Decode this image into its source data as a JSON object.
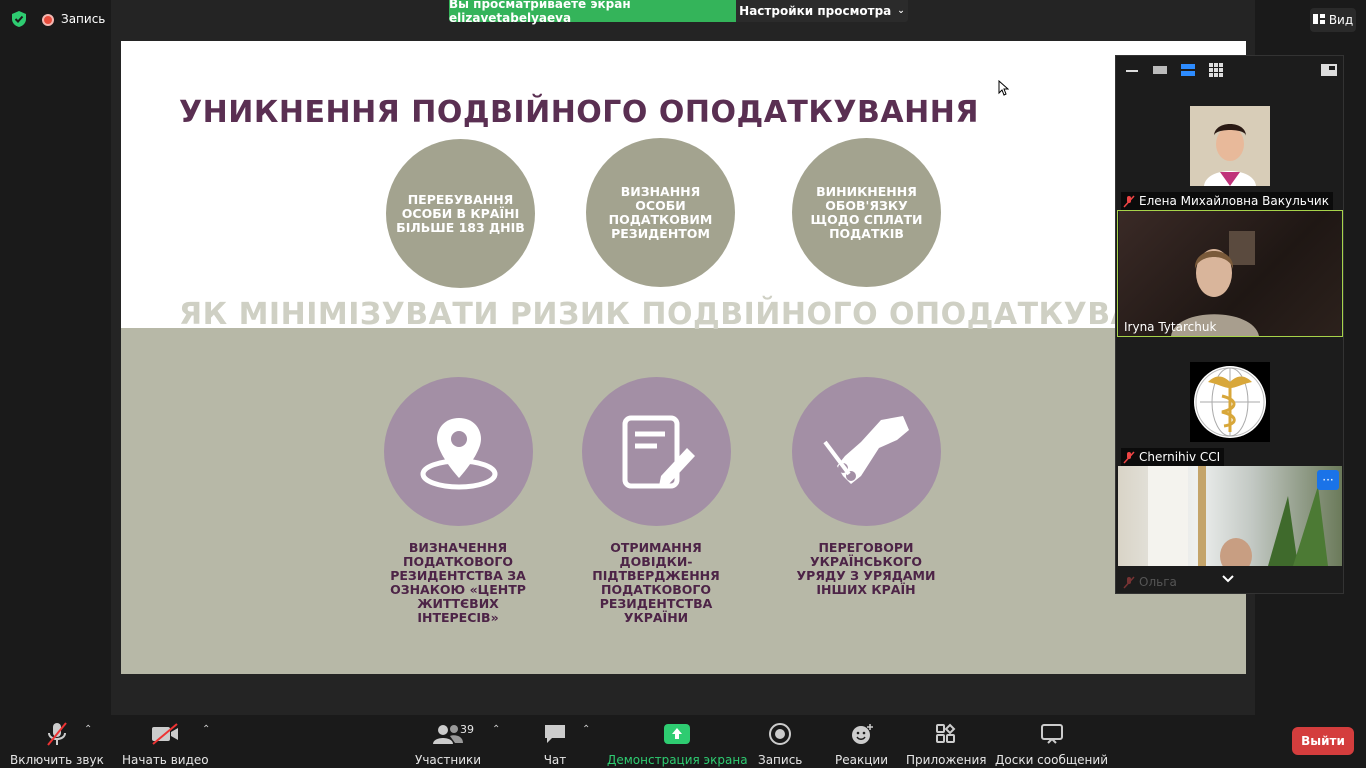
{
  "topbar": {
    "record_label": "Запись",
    "viewing_banner": "Вы просматриваете экран elizavetabelyaeva",
    "view_settings": "Настройки просмотра",
    "view_button": "Вид"
  },
  "slide": {
    "title": "УНИКНЕННЯ ПОДВІЙНОГО ОПОДАТКУВАННЯ",
    "subtitle": "ЯК МІНІМІЗУВАТИ РИЗИК ПОДВІЙНОГО ОПОДАТКУВАННЯ",
    "circles_top": [
      "ПЕРЕБУВАННЯ ОСОБИ В КРАЇНІ БІЛЬШЕ 183 ДНІВ",
      "ВИЗНАННЯ ОСОБИ ПОДАТКОВИМ РЕЗИДЕНТОМ",
      "ВИНИКНЕННЯ ОБОВ'ЯЗКУ ЩОДО СПЛАТИ ПОДАТКІВ"
    ],
    "captions_bottom": [
      "ВИЗНАЧЕННЯ ПОДАТКОВОГО РЕЗИДЕНТСТВА ЗА ОЗНАКОЮ «ЦЕНТР ЖИТТЄВИХ ІНТЕРЕСІВ»",
      "ОТРИМАННЯ ДОВІДКИ-ПІДТВЕРДЖЕННЯ ПОДАТКОВОГО РЕЗИДЕНТСТВА УКРАЇНИ",
      "ПЕРЕГОВОРИ УКРАЇНСЬКОГО УРЯДУ З УРЯДАМИ ІНШИХ КРАЇН"
    ],
    "icons_bottom": [
      "map-pin-icon",
      "document-edit-icon",
      "handshake-icon"
    ]
  },
  "participants": [
    {
      "name": "Елена Михайловна Вакульчик",
      "muted": true
    },
    {
      "name": "Iryna Tytarchuk",
      "muted": false
    },
    {
      "name": "Chernihiv CCI",
      "muted": true
    },
    {
      "name": "Ольга",
      "muted": true
    }
  ],
  "toolbar": {
    "mute": "Включить звук",
    "video": "Начать видео",
    "participants": "Участники",
    "participants_count": "39",
    "chat": "Чат",
    "share": "Демонстрация экрана",
    "record": "Запись",
    "reactions": "Реакции",
    "apps": "Приложения",
    "whiteboards": "Доски сообщений",
    "leave": "Выйти"
  },
  "colors": {
    "share_green": "#34b45a",
    "leave_red": "#d43d3d",
    "slide_title": "#5a2f52",
    "circle_gray": "#a3a38f",
    "circle_purple": "#a38fa5",
    "slide_bottom_bg": "#b7b8a7"
  }
}
